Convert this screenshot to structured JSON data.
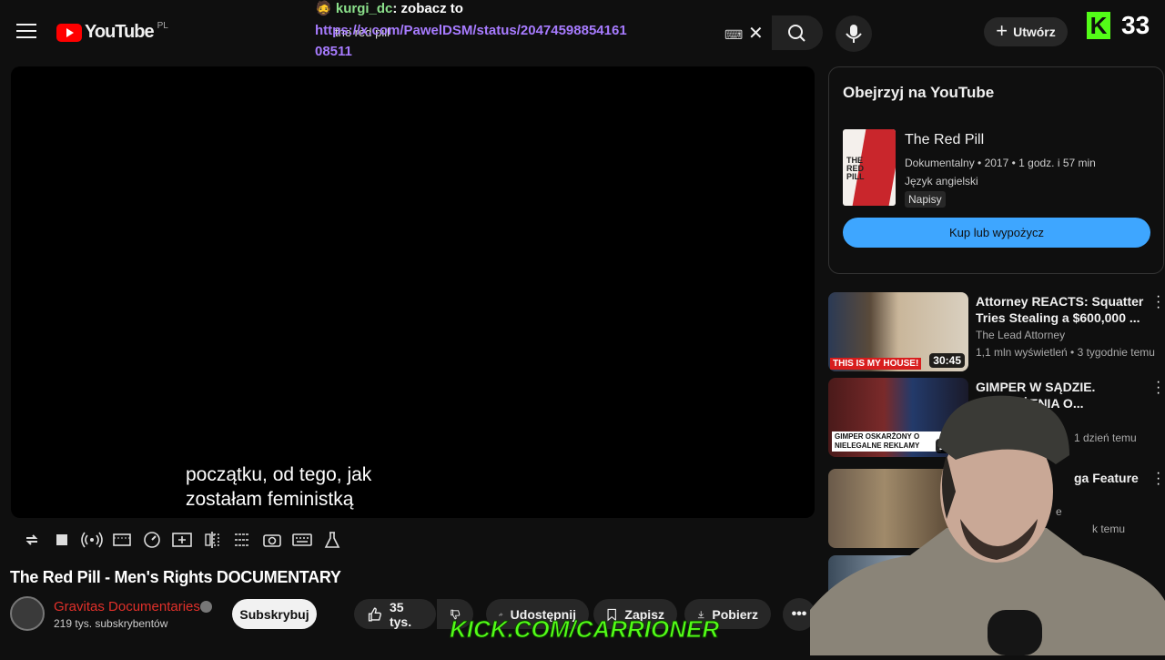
{
  "header": {
    "logo_text": "YouTube",
    "country_code": "PL",
    "search_query": "the red pill",
    "create_label": "Utwórz"
  },
  "chat_overlay": {
    "username": "kurgi_dc",
    "message": ": zobacz to",
    "link": "https://x.com/PawelDSM/status/2047459885416108511"
  },
  "kick_overlay": {
    "viewer_count": "33",
    "url": "KICK.COM/CARRIONER",
    "color": "#53fc18"
  },
  "player": {
    "subtitle_line1": "początku, od tego, jak",
    "subtitle_line2": "zostałam feministką"
  },
  "video": {
    "title": "The Red Pill - Men's Rights DOCUMENTARY",
    "channel": "Gravitas Documentaries",
    "subscribers": "219 tys. subskrybentów",
    "subscribe_label": "Subskrybuj",
    "likes": "35 tys.",
    "share_label": "Udostępnij",
    "save_label": "Zapisz",
    "download_label": "Pobierz"
  },
  "watch_panel": {
    "heading": "Obejrzyj na YouTube",
    "film_title": "The Red Pill",
    "film_meta": "Dokumentalny • 2017 • 1 godz. i 57 min",
    "film_language": "Język angielski",
    "film_badge": "Napisy",
    "buy_label": "Kup lub wypożycz",
    "accent": "#3ea6ff"
  },
  "recommendations": [
    {
      "title": "Attorney REACTS: Squatter Tries Stealing a $600,000 ...",
      "channel": "The Lead Attorney",
      "meta": "1,1 mln wyświetleń • 3 tygodnie temu",
      "duration": "30:45",
      "thumb_text": "THIS IS MY HOUSE!"
    },
    {
      "title": "GIMPER W SĄDZIE. OSKARŻENIA O...",
      "channel": "",
      "meta": "1 dzień temu",
      "duration": "29:3",
      "thumb_text": "GIMPER OSKARŻONY O NIELEGALNE REKLAMY"
    },
    {
      "title": "ga Feature",
      "channel": "e",
      "meta": "k temu",
      "duration": "",
      "thumb_text": ""
    }
  ]
}
